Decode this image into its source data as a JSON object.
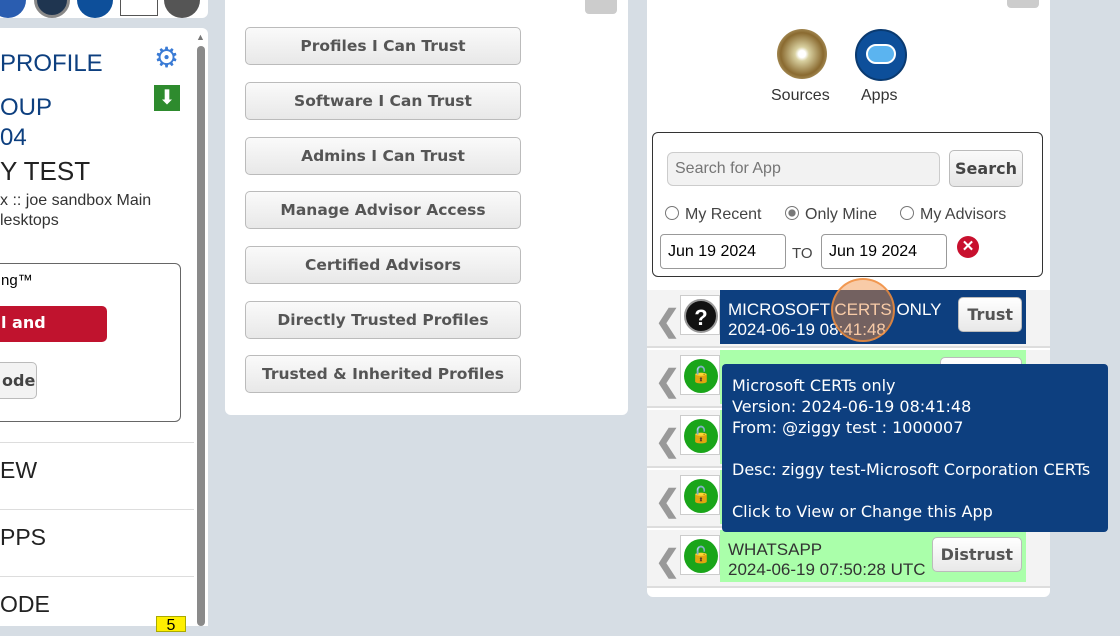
{
  "left": {
    "title": "PROFILE",
    "group": "OUP",
    "group_num": "04",
    "name": "Y TEST",
    "path_line1": "x :: joe sandbox Main",
    "path_line2": "lesktops",
    "box_title": "ng™",
    "install_button": "l and Install",
    "code_button": "ode",
    "menu": [
      "EW",
      "PPS",
      "ODE"
    ],
    "badge": "5"
  },
  "middle": {
    "buttons": [
      "Profiles I Can Trust",
      "Software I Can Trust",
      "Admins I Can Trust",
      "Manage Advisor Access",
      "Certified Advisors",
      "Directly Trusted Profiles",
      "Trusted & Inherited Profiles"
    ]
  },
  "right": {
    "sources_label": "Sources",
    "apps_label": "Apps",
    "search_placeholder": "Search for App",
    "search_button": "Search",
    "radios": [
      {
        "label": "My Recent",
        "checked": false
      },
      {
        "label": "Only Mine",
        "checked": true
      },
      {
        "label": "My Advisors",
        "checked": false
      }
    ],
    "date_from": "Jun 19 2024",
    "to_label": "TO",
    "date_to": "Jun 19 2024",
    "rows": [
      {
        "name": "MICROSOFT CERTS ONLY",
        "time": "2024-06-19 08:41:48",
        "button": "Trust",
        "status": "unknown",
        "color": "#0d3f7f"
      },
      {
        "status": "trusted",
        "color": "#aaffaa"
      },
      {
        "status": "trusted",
        "color": "#aaffaa"
      },
      {
        "status": "trusted",
        "color": "#aaffaa"
      },
      {
        "name": "WHATSAPP",
        "time": "2024-06-19 07:50:28 UTC",
        "button": "Distrust",
        "status": "trusted",
        "color": "#aaffaa"
      }
    ]
  },
  "tooltip": {
    "line1": "Microsoft CERTs only",
    "line2": "Version: 2024-06-19 08:41:48",
    "line3": "From: @ziggy test : 1000007",
    "line4": "Desc: ziggy test-Microsoft Corporation CERTs",
    "line5": "Click to View or Change this App"
  }
}
